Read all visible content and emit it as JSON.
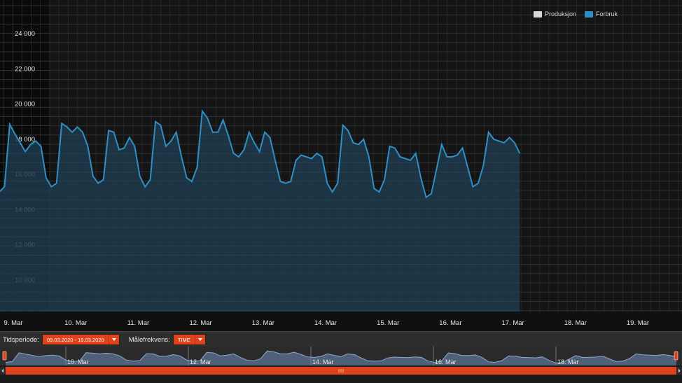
{
  "chart_data": {
    "type": "area",
    "title": "",
    "ylabel": "",
    "xlabel": "",
    "ylim": [
      8200,
      25600
    ],
    "y_ticks": [
      10000,
      12000,
      14000,
      16000,
      18000,
      20000,
      22000,
      24000
    ],
    "y_tick_labels": [
      "10 000",
      "12 000",
      "14 000",
      "16 000",
      "18 000",
      "20 000",
      "22 000",
      "24 000"
    ],
    "x_tick_labels": [
      "9. Mar",
      "10. Mar",
      "11. Mar",
      "12. Mar",
      "13. Mar",
      "14. Mar",
      "15. Mar",
      "16. Mar",
      "17. Mar",
      "18. Mar",
      "19. Mar"
    ],
    "x_hours_per_point": 2,
    "legend_position": "top-right",
    "grid": true,
    "series": [
      {
        "name": "Produksjon",
        "color": "#d9d9d9",
        "values": []
      },
      {
        "name": "Forbruk",
        "color": "#2f8fc4",
        "values": [
          15000,
          15300,
          18850,
          18300,
          17800,
          17300,
          17700,
          17900,
          17600,
          15800,
          15300,
          15500,
          18900,
          18700,
          18400,
          18700,
          18400,
          17600,
          15900,
          15500,
          15700,
          18500,
          18400,
          17400,
          17500,
          18100,
          17600,
          15900,
          15300,
          15700,
          19000,
          18800,
          17600,
          17900,
          18400,
          17000,
          15800,
          15600,
          16400,
          19600,
          19200,
          18400,
          18400,
          19100,
          18200,
          17200,
          17000,
          17400,
          18400,
          17800,
          17300,
          18400,
          18100,
          16800,
          15600,
          15500,
          15600,
          16800,
          17100,
          17000,
          16900,
          17200,
          17000,
          15500,
          15000,
          15500,
          18800,
          18500,
          17800,
          17700,
          18000,
          17000,
          15200,
          15000,
          15700,
          17600,
          17500,
          17000,
          16900,
          16800,
          17200,
          15800,
          14700,
          14900,
          16300,
          17700,
          17000,
          17000,
          17100,
          17500,
          16400,
          15300,
          15500,
          16500,
          18400,
          18000,
          17900,
          17800,
          18100,
          17800,
          17200
        ]
      }
    ]
  },
  "controls": {
    "period_label": "Tidsperiode:",
    "period_value": "09.03.2020 - 19.03.2020",
    "freq_label": "Målefrekvens:",
    "freq_value": "TIME"
  },
  "navigator": {
    "labels": [
      "10. Mar",
      "12. Mar",
      "14. Mar",
      "16. Mar",
      "18. Mar"
    ],
    "scroll_handle_icon": "grip-lines-icon",
    "scroll_left_icon": "arrow-left-icon",
    "scroll_right_icon": "arrow-right-icon",
    "accent_color": "#e0421c"
  }
}
